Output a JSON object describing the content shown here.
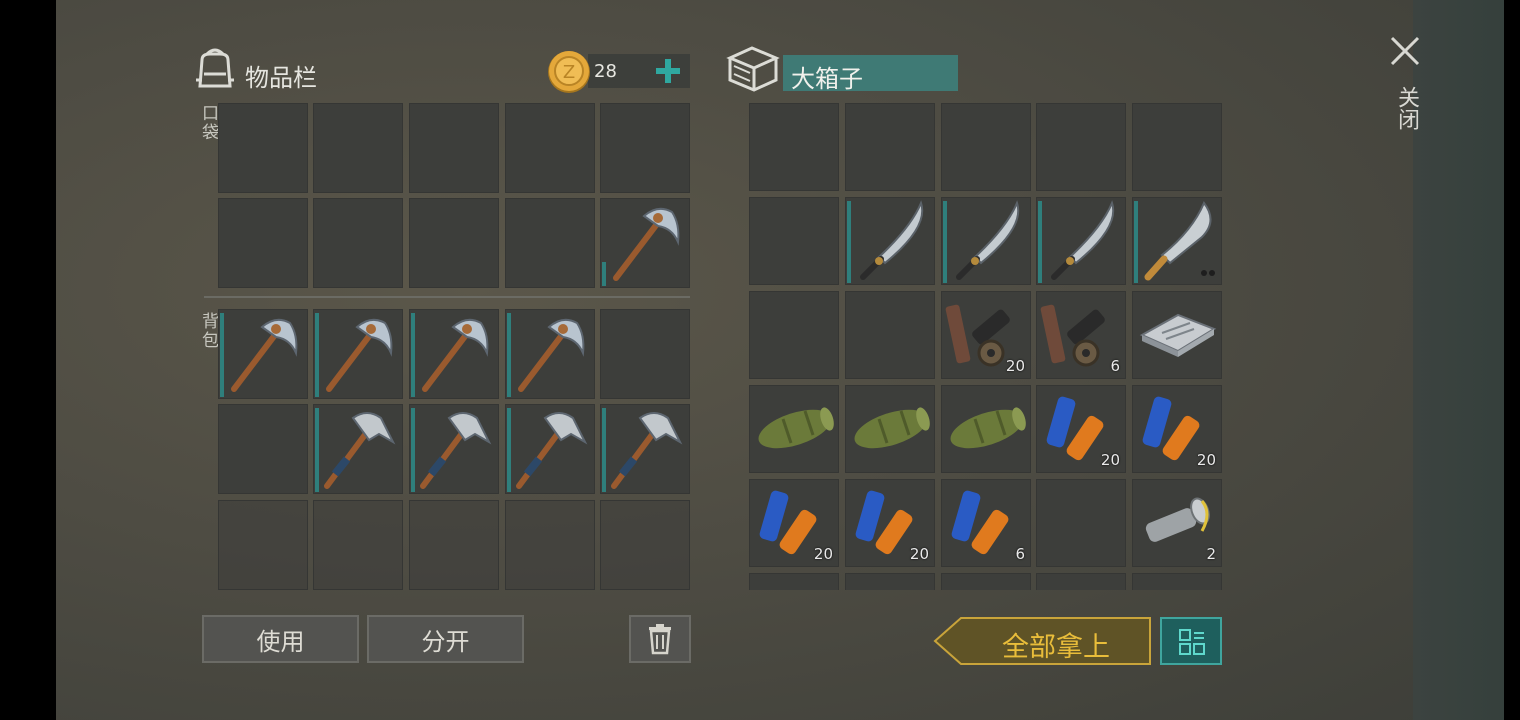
{
  "inventory": {
    "title": "物品栏",
    "coins": "28",
    "pocket_label": "口袋",
    "backpack_label": "背包",
    "use_label": "使用",
    "split_label": "分开"
  },
  "container": {
    "title": "大箱子",
    "take_all_label": "全部拿上"
  },
  "close_label": "关闭",
  "colors": {
    "accent_teal": "#2f7f7c",
    "take_all_gold": "#e0b637",
    "take_all_bg": "#5f5326"
  },
  "quantities": {
    "binocular_parts_a": "20",
    "binocular_parts_b": "6",
    "batteries_a": "20",
    "batteries_b": "20",
    "batteries_c": "20",
    "batteries_d": "20",
    "batteries_e": "6",
    "flashlight": "2"
  },
  "icons": [
    "backpack-icon",
    "coin-icon",
    "plus-icon",
    "crate-icon",
    "close-icon",
    "trash-icon",
    "layout-icon",
    "pickaxe-icon",
    "hammer-icon",
    "machete-icon",
    "scope-parts-icon",
    "circuit-board-icon",
    "sleeping-mat-icon",
    "battery-icon",
    "flashlight-icon"
  ]
}
